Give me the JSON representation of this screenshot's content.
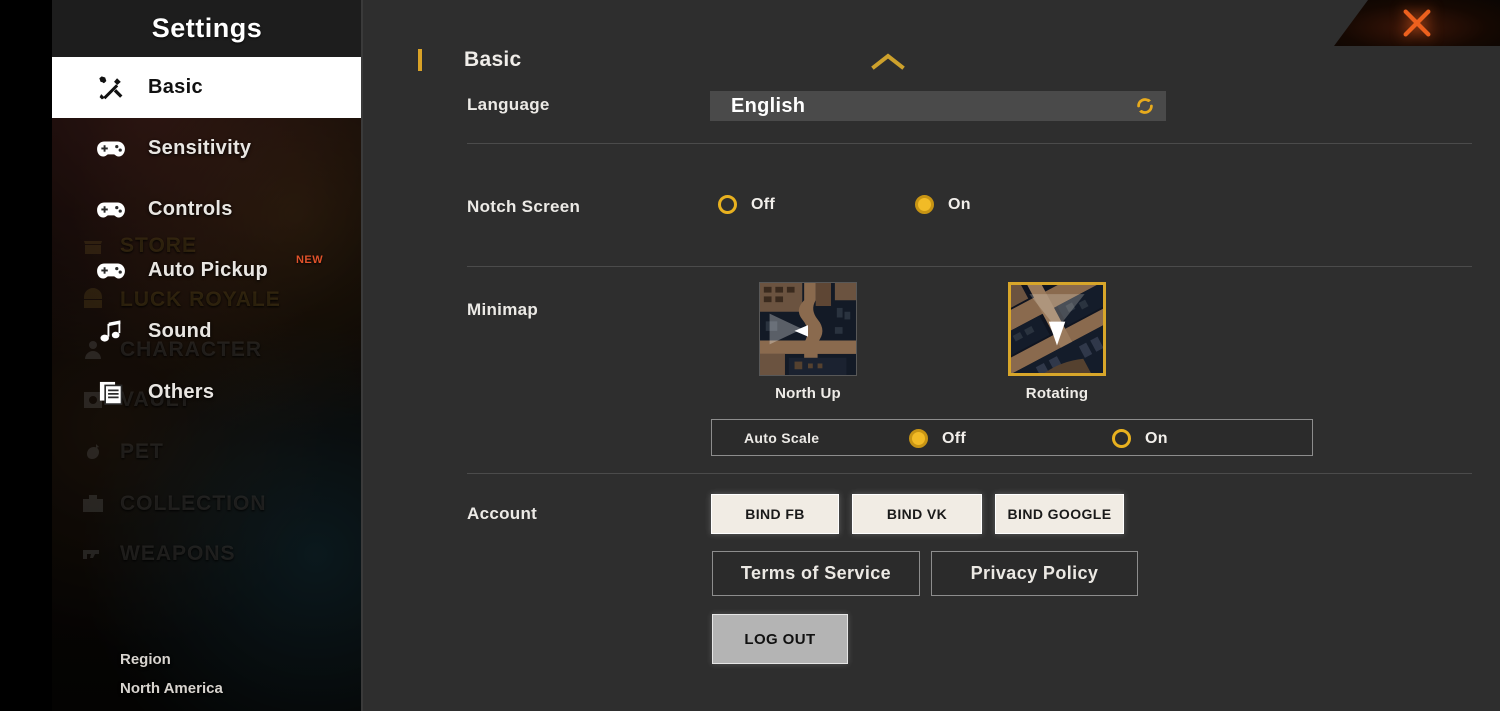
{
  "window": {
    "close_label": "close-button"
  },
  "sidebar": {
    "title": "Settings",
    "items": [
      {
        "label": "Basic",
        "icon": "tools-icon",
        "active": true,
        "badge": ""
      },
      {
        "label": "Sensitivity",
        "icon": "gamepad-icon",
        "active": false,
        "badge": ""
      },
      {
        "label": "Controls",
        "icon": "gamepad-icon",
        "active": false,
        "badge": ""
      },
      {
        "label": "Auto Pickup",
        "icon": "gamepad-icon",
        "active": false,
        "badge": "NEW"
      },
      {
        "label": "Sound",
        "icon": "music-note-icon",
        "active": false,
        "badge": ""
      },
      {
        "label": "Others",
        "icon": "document-icon",
        "active": false,
        "badge": ""
      }
    ],
    "region_label": "Region",
    "region_value": "North America"
  },
  "background_menu": {
    "items": [
      {
        "label": "STORE",
        "icon": "store-icon"
      },
      {
        "label": "LUCK ROYALE",
        "icon": "chest-icon"
      },
      {
        "label": "CHARACTER",
        "icon": "character-icon"
      },
      {
        "label": "VAULT",
        "icon": "vault-icon"
      },
      {
        "label": "PET",
        "icon": "pet-icon"
      },
      {
        "label": "COLLECTION",
        "icon": "collection-icon"
      },
      {
        "label": "WEAPONS",
        "icon": "weapon-icon"
      }
    ]
  },
  "main": {
    "section_title": "Basic",
    "language": {
      "label": "Language",
      "value": "English",
      "refresh_icon": "refresh-icon"
    },
    "notch_screen": {
      "label": "Notch Screen",
      "options": [
        {
          "label": "Off",
          "selected": false
        },
        {
          "label": "On",
          "selected": true
        }
      ]
    },
    "minimap": {
      "label": "Minimap",
      "modes": [
        {
          "label": "North Up",
          "selected": false
        },
        {
          "label": "Rotating",
          "selected": true
        }
      ],
      "auto_scale": {
        "label": "Auto Scale",
        "options": [
          {
            "label": "Off",
            "selected": true
          },
          {
            "label": "On",
            "selected": false
          }
        ]
      }
    },
    "account": {
      "label": "Account",
      "bind_buttons": [
        {
          "label": "BIND FB"
        },
        {
          "label": "BIND VK"
        },
        {
          "label": "BIND GOOGLE"
        }
      ],
      "link_buttons": [
        {
          "label": "Terms of Service"
        },
        {
          "label": "Privacy Policy"
        }
      ],
      "logout_label": "LOG OUT"
    }
  },
  "colors": {
    "accent_gold": "#d9a227",
    "radio_gold": "#f2bb26",
    "panel_bg": "#2e2e2e",
    "close_orange": "#ec601e",
    "badge_orange": "#e0522a"
  }
}
